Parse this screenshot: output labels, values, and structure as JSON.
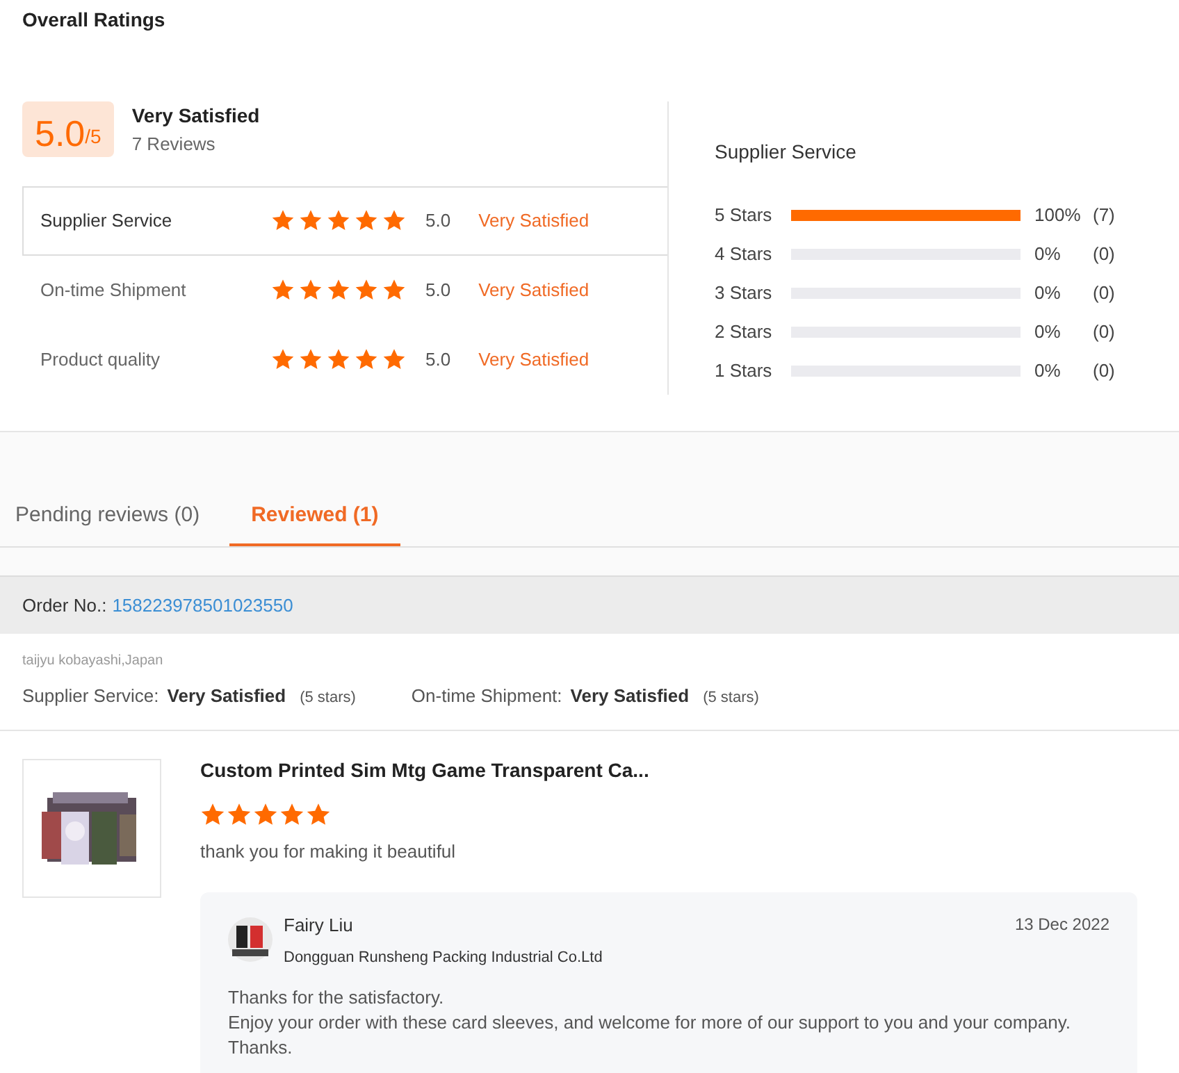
{
  "title": "Overall Ratings",
  "summary": {
    "score": "5.0",
    "out_of": "/5",
    "verdict": "Very Satisfied",
    "reviews": "7 Reviews"
  },
  "ratings": [
    {
      "label": "Supplier Service",
      "stars": 5,
      "score": "5.0",
      "verdict": "Very Satisfied",
      "selected": true
    },
    {
      "label": "On-time Shipment",
      "stars": 5,
      "score": "5.0",
      "verdict": "Very Satisfied",
      "selected": false
    },
    {
      "label": "Product quality",
      "stars": 5,
      "score": "5.0",
      "verdict": "Very Satisfied",
      "selected": false
    }
  ],
  "breakdown": {
    "title": "Supplier Service",
    "rows": [
      {
        "label": "5 Stars",
        "level": 1,
        "percent": "100%",
        "count": "(7)"
      },
      {
        "label": "4 Stars",
        "level": 0,
        "percent": "0%",
        "count": "(0)"
      },
      {
        "label": "3 Stars",
        "level": 0,
        "percent": "0%",
        "count": "(0)"
      },
      {
        "label": "2 Stars",
        "level": 0,
        "percent": "0%",
        "count": "(0)"
      },
      {
        "label": "1 Stars",
        "level": 0,
        "percent": "0%",
        "count": "(0)"
      }
    ]
  },
  "tabs": [
    {
      "label": "Pending reviews (0)",
      "selected": false
    },
    {
      "label": "Reviewed (1)",
      "selected": true
    }
  ],
  "order": {
    "label": "Order No.:",
    "number": "158223978501023550"
  },
  "review": {
    "reviewer": "taijyu kobayashi,Japan",
    "scores": [
      {
        "label": "Supplier Service:",
        "verdict": "Very Satisfied",
        "stars": "(5 stars)"
      },
      {
        "label": "On-time Shipment:",
        "verdict": "Very Satisfied",
        "stars": "(5 stars)"
      }
    ],
    "product": "Custom Printed Sim Mtg Game Transparent Ca...",
    "stars": 5,
    "comment": "thank you for making it beautiful",
    "reply": {
      "name": "Fairy Liu",
      "company": "Dongguan Runsheng Packing Industrial Co.Ltd",
      "date": "13 Dec 2022",
      "lines": [
        "Thanks for the satisfactory.",
        "Enjoy your order with these card sleeves, and welcome for more of our support to you and your company.",
        "Thanks."
      ]
    }
  }
}
